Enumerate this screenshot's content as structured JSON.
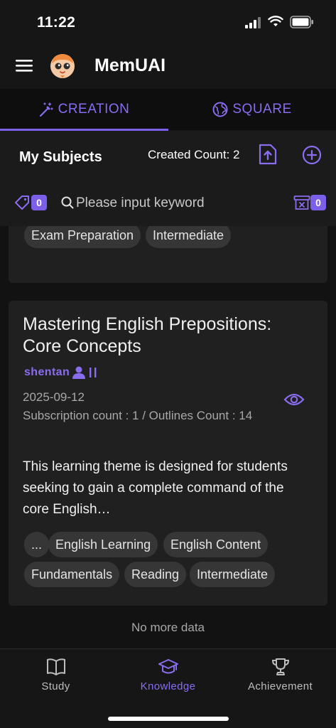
{
  "status_bar": {
    "time": "11:22"
  },
  "app": {
    "title": "MemUAI"
  },
  "tabs": [
    {
      "label": "CREATION",
      "active": true
    },
    {
      "label": "SQUARE",
      "active": false
    }
  ],
  "subjects": {
    "heading": "My Subjects",
    "created_count": "Created Count: 2",
    "tag_count": "0",
    "trash_count": "0",
    "search_placeholder": "Please input keyword"
  },
  "cards": [
    {
      "tags": [
        "Exam Preparation",
        "Intermediate"
      ]
    },
    {
      "title": "Mastering English Prepositions: Core Concepts",
      "author": "shentan",
      "date": "2025-09-12",
      "meta": "Subscription count : 1 / Outlines Count : 14",
      "description": "This learning theme is designed for students seeking to gain a complete command of the core English…",
      "tags": [
        "...",
        "English Learning",
        "English Content",
        "Fundamentals",
        "Reading",
        "Intermediate"
      ]
    }
  ],
  "list_footer": "No more data",
  "bottom_nav": [
    {
      "label": "Study",
      "icon": "book-icon"
    },
    {
      "label": "Knowledge",
      "icon": "graduation-cap-icon",
      "active": true
    },
    {
      "label": "Achievement",
      "icon": "trophy-icon"
    }
  ],
  "colors": {
    "accent": "#7b5fe8",
    "background": "#121212",
    "card": "#202020",
    "chip": "#363636"
  }
}
